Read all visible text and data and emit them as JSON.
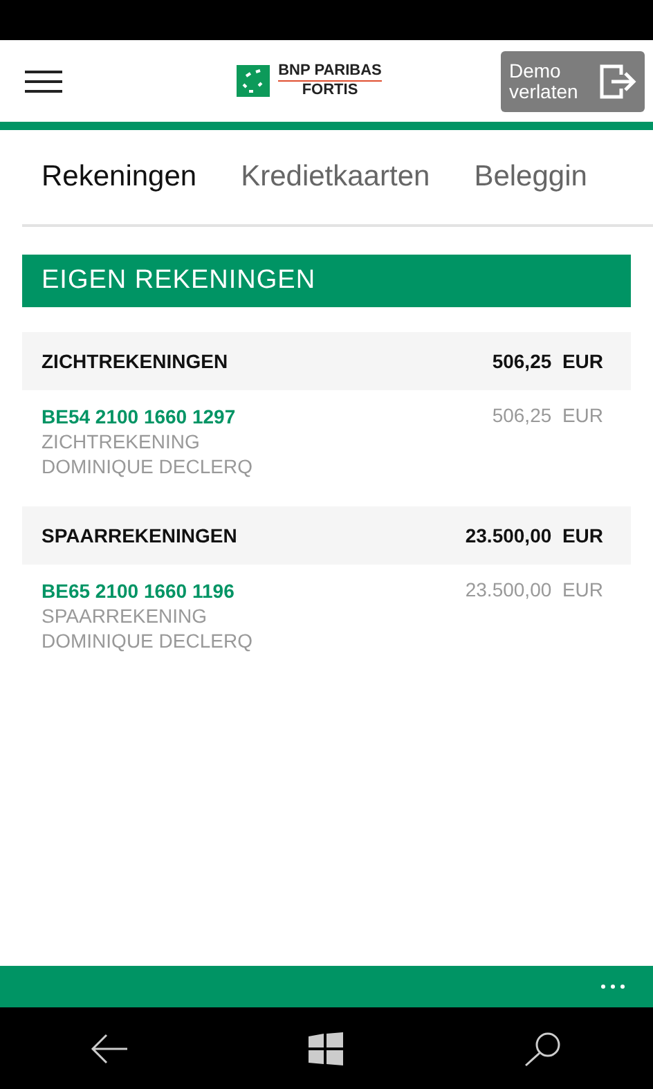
{
  "header": {
    "logo": {
      "line_1": "BNP PARIBAS",
      "line_2": "FORTIS"
    },
    "exit_button": {
      "line_1": "Demo",
      "line_2": "verlaten"
    }
  },
  "tabs": [
    {
      "label": "Rekeningen",
      "selected": true
    },
    {
      "label": "Kredietkaarten",
      "selected": false
    },
    {
      "label": "Beleggin",
      "selected": false
    }
  ],
  "section": {
    "title": "EIGEN REKENINGEN"
  },
  "groups": [
    {
      "name": "ZICHTREKENINGEN",
      "amount": "506,25",
      "currency": "EUR",
      "accounts": [
        {
          "iban": "BE54 2100 1660 1297",
          "type": "ZICHTREKENING",
          "holder": "DOMINIQUE DECLERQ",
          "amount": "506,25",
          "currency": "EUR"
        }
      ]
    },
    {
      "name": "SPAARREKENINGEN",
      "amount": "23.500,00",
      "currency": "EUR",
      "accounts": [
        {
          "iban": "BE65 2100 1660 1196",
          "type": "SPAARREKENING",
          "holder": "DOMINIQUE DECLERQ",
          "amount": "23.500,00",
          "currency": "EUR"
        }
      ]
    }
  ]
}
